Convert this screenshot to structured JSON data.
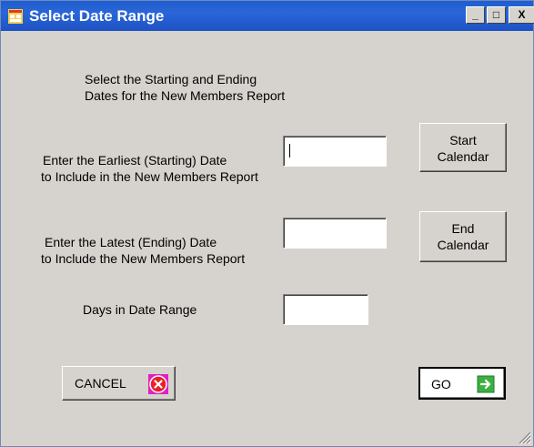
{
  "window": {
    "title": "Select Date Range",
    "controls": {
      "minimize": "_",
      "maximize": "□",
      "close": "X"
    }
  },
  "instructions": {
    "line1": "Select the Starting and Ending",
    "line2": "Dates for the New Members Report"
  },
  "start": {
    "label_line1": "Enter the Earliest (Starting) Date",
    "label_line2": "to Include in the New Members Report",
    "value": "",
    "button_line1": "Start",
    "button_line2": "Calendar"
  },
  "end": {
    "label_line1": "Enter the Latest (Ending) Date",
    "label_line2": "to Include the New Members Report",
    "value": "",
    "button_line1": "End",
    "button_line2": "Calendar"
  },
  "days": {
    "label": "Days in Date Range",
    "value": ""
  },
  "buttons": {
    "cancel": "CANCEL",
    "go": "GO"
  },
  "colors": {
    "titlebar": "#2a66d8",
    "form_background": "#d6d3ce",
    "cancel_icon": "#e8202a",
    "go_icon": "#3cb043"
  },
  "icons": {
    "app": "form-icon",
    "cancel": "cancel-x-icon",
    "go": "go-arrow-icon",
    "resize": "resize-grip-icon"
  }
}
